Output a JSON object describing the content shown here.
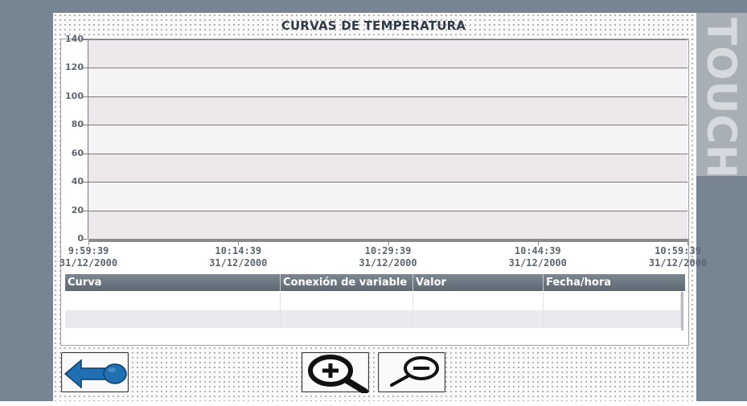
{
  "screen": {
    "title": "CURVAS DE TEMPERATURA",
    "watermark": "TOUCH"
  },
  "trend": {
    "y_axis": {
      "min": 0,
      "max": 140,
      "ticks": [
        "140",
        "120",
        "100",
        "80",
        "60",
        "40",
        "20",
        "0"
      ]
    },
    "x_axis": {
      "ticks": [
        {
          "time": "9:59:39",
          "date": "31/12/2000"
        },
        {
          "time": "10:14:39",
          "date": "31/12/2000"
        },
        {
          "time": "10:29:39",
          "date": "31/12/2000"
        },
        {
          "time": "10:44:39",
          "date": "31/12/2000"
        },
        {
          "time": "10:59:39",
          "date": "31/12/2000"
        }
      ]
    }
  },
  "table": {
    "columns": [
      "Curva",
      "Conexión de variable",
      "Valor",
      "Fecha/hora"
    ],
    "rows": [
      [
        "",
        "",
        "",
        ""
      ],
      [
        "",
        "",
        "",
        ""
      ]
    ]
  },
  "buttons": {
    "back": {
      "icon": "back-arrow-icon",
      "color": "#1f6fb2"
    },
    "zoom_in": {
      "icon": "zoom-in-icon"
    },
    "zoom_out": {
      "icon": "zoom-out-icon"
    }
  },
  "colors": {
    "background": "#778492",
    "header": "#6b7580",
    "accent_blue": "#1f6fb2"
  }
}
